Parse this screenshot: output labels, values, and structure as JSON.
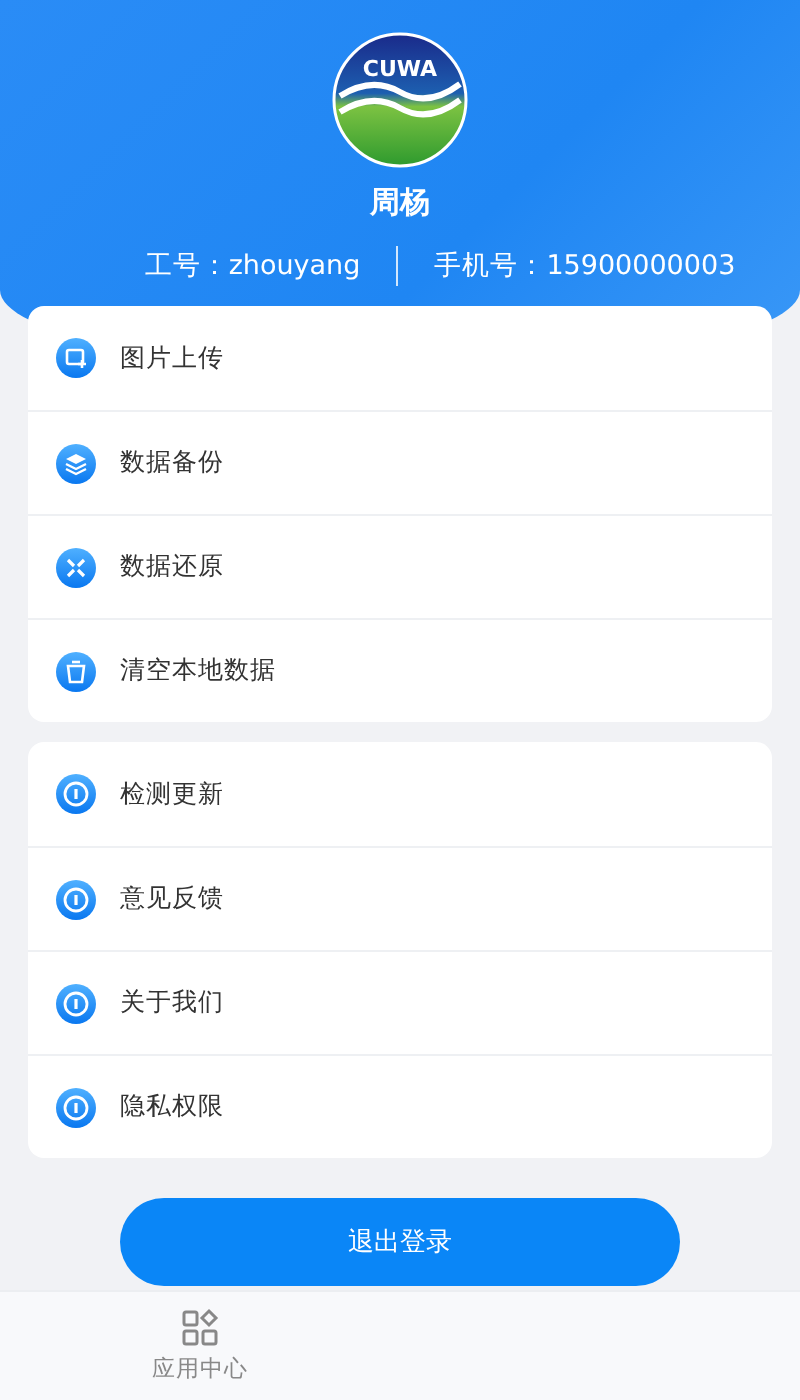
{
  "profile": {
    "logo_text": "CUWA",
    "name": "周杨",
    "employee_id": "工号：zhouyang",
    "phone": "手机号：15900000003"
  },
  "groups": [
    {
      "items": [
        {
          "label": "图片上传",
          "kind": "upload"
        },
        {
          "label": "数据备份",
          "kind": "backup"
        },
        {
          "label": "数据还原",
          "kind": "restore"
        },
        {
          "label": "清空本地数据",
          "kind": "clear"
        }
      ]
    },
    {
      "items": [
        {
          "label": "检测更新",
          "kind": "info"
        },
        {
          "label": "意见反馈",
          "kind": "info"
        },
        {
          "label": "关于我们",
          "kind": "info"
        },
        {
          "label": "隐私权限",
          "kind": "info"
        }
      ]
    }
  ],
  "logout_button": "退出登录",
  "tabs": [
    {
      "label": "应用中心",
      "selected": false
    }
  ]
}
